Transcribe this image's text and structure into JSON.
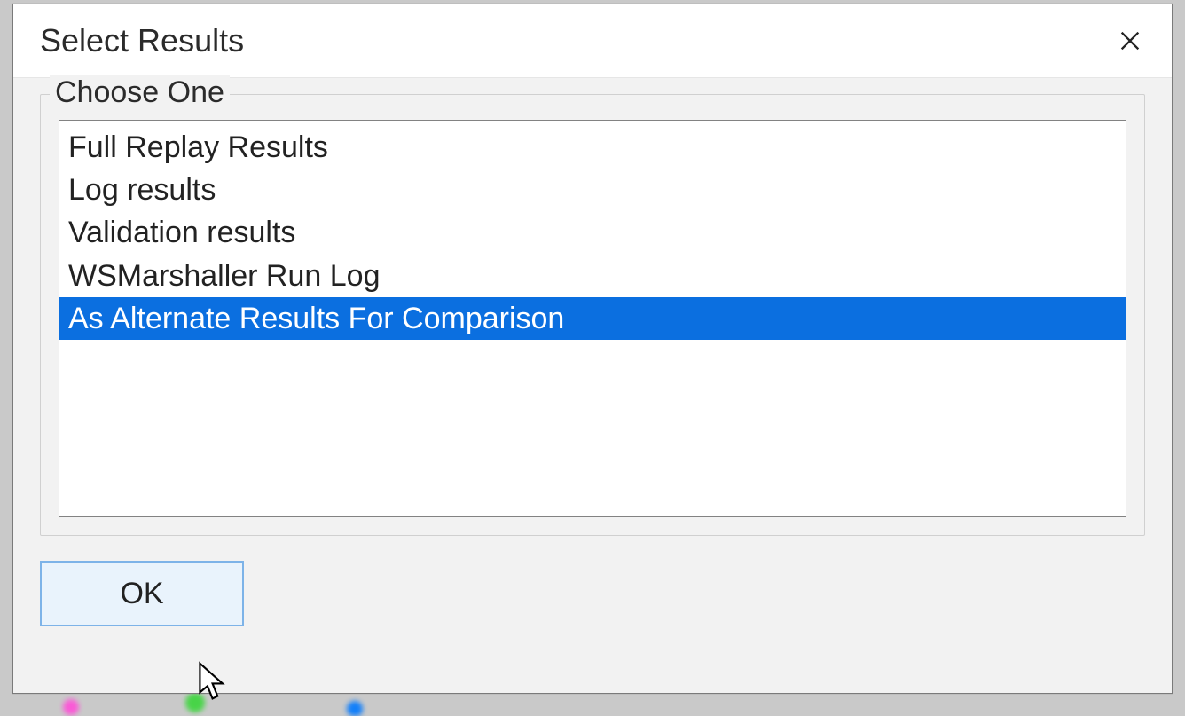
{
  "dialog": {
    "title": "Select Results",
    "group_label": "Choose One",
    "ok_label": "OK",
    "close_icon": "close-icon"
  },
  "list": {
    "items": [
      {
        "label": "Full Replay Results",
        "selected": false
      },
      {
        "label": "Log results",
        "selected": false
      },
      {
        "label": "Validation results",
        "selected": false
      },
      {
        "label": "WSMarshaller Run Log",
        "selected": false
      },
      {
        "label": "As Alternate Results For Comparison",
        "selected": true
      }
    ]
  },
  "colors": {
    "selection": "#0b6fe0",
    "dialog_bg": "#f2f2f2",
    "button_border": "#7db3e8",
    "button_bg": "#e9f3fc"
  }
}
